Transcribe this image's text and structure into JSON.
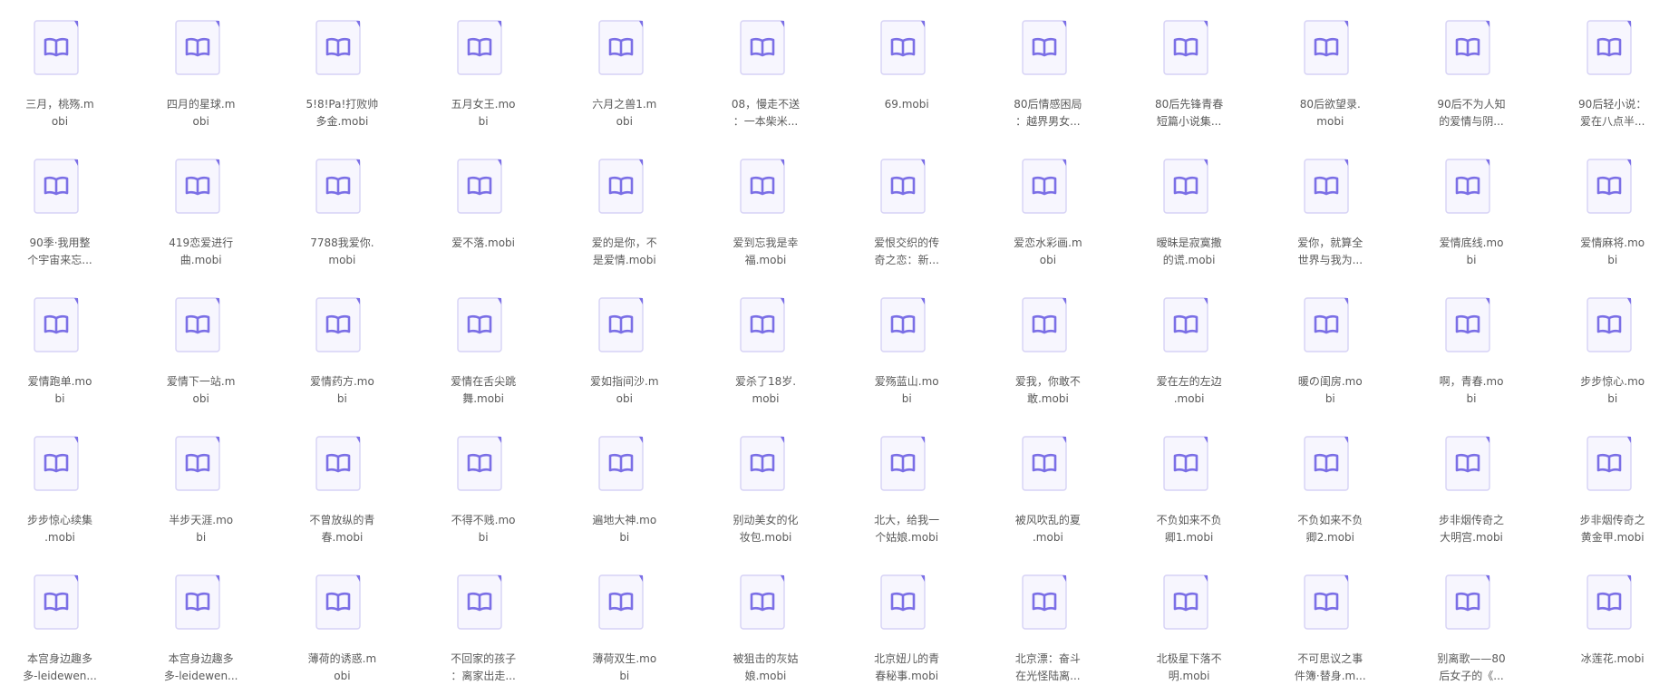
{
  "file_icon": "ebook-file-icon",
  "colors": {
    "icon_outline": "#d6d2f5",
    "icon_fill": "#f7f6fe",
    "icon_accent": "#7b6fe6",
    "text": "#5a5a5a"
  },
  "files": [
    {
      "lines": [
        "三月，桃殇.m",
        "obi"
      ]
    },
    {
      "lines": [
        "四月的星球.m",
        "obi"
      ]
    },
    {
      "lines": [
        "5!8!Pa!打败帅",
        "多金.mobi"
      ]
    },
    {
      "lines": [
        "五月女王.mo",
        "bi"
      ]
    },
    {
      "lines": [
        "六月之兽1.m",
        "obi"
      ]
    },
    {
      "lines": [
        "08，慢走不送",
        "：一本柴米..."
      ]
    },
    {
      "lines": [
        "69.mobi"
      ]
    },
    {
      "lines": [
        "80后情感困局",
        "：越界男女..."
      ]
    },
    {
      "lines": [
        "80后先锋青春",
        "短篇小说集..."
      ]
    },
    {
      "lines": [
        "80后欲望录.",
        "mobi"
      ]
    },
    {
      "lines": [
        "90后不为人知",
        "的爱情与阴..."
      ]
    },
    {
      "lines": [
        "90后轻小说：",
        "爱在八点半..."
      ]
    },
    {
      "lines": [
        "90季·我用整",
        "个宇宙来忘..."
      ]
    },
    {
      "lines": [
        "419恋爱进行",
        "曲.mobi"
      ]
    },
    {
      "lines": [
        "7788我爱你.",
        "mobi"
      ]
    },
    {
      "lines": [
        "爱不落.mobi"
      ]
    },
    {
      "lines": [
        "爱的是你，不",
        "是爱情.mobi"
      ]
    },
    {
      "lines": [
        "爱到忘我是幸",
        "福.mobi"
      ]
    },
    {
      "lines": [
        "爱恨交织的传",
        "奇之恋：新..."
      ]
    },
    {
      "lines": [
        "爱恋水彩画.m",
        "obi"
      ]
    },
    {
      "lines": [
        "暧昧是寂寞撒",
        "的谎.mobi"
      ]
    },
    {
      "lines": [
        "爱你，就算全",
        "世界与我为..."
      ]
    },
    {
      "lines": [
        "爱情底线.mo",
        "bi"
      ]
    },
    {
      "lines": [
        "爱情麻将.mo",
        "bi"
      ]
    },
    {
      "lines": [
        "爱情跑单.mo",
        "bi"
      ]
    },
    {
      "lines": [
        "爱情下一站.m",
        "obi"
      ]
    },
    {
      "lines": [
        "爱情药方.mo",
        "bi"
      ]
    },
    {
      "lines": [
        "爱情在舌尖跳",
        "舞.mobi"
      ]
    },
    {
      "lines": [
        "爱如指间沙.m",
        "obi"
      ]
    },
    {
      "lines": [
        "爱杀了18岁.",
        "mobi"
      ]
    },
    {
      "lines": [
        "爱殇蓝山.mo",
        "bi"
      ]
    },
    {
      "lines": [
        "爱我，你敢不",
        "敢.mobi"
      ]
    },
    {
      "lines": [
        "爱在左的左边",
        ".mobi"
      ]
    },
    {
      "lines": [
        "暖の闺房.mo",
        "bi"
      ]
    },
    {
      "lines": [
        "啊，青春.mo",
        "bi"
      ]
    },
    {
      "lines": [
        "步步惊心.mo",
        "bi"
      ]
    },
    {
      "lines": [
        "步步惊心续集",
        ".mobi"
      ]
    },
    {
      "lines": [
        "半步天涯.mo",
        "bi"
      ]
    },
    {
      "lines": [
        "不曾放纵的青",
        "春.mobi"
      ]
    },
    {
      "lines": [
        "不得不贱.mo",
        "bi"
      ]
    },
    {
      "lines": [
        "遍地大神.mo",
        "bi"
      ]
    },
    {
      "lines": [
        "别动美女的化",
        "妆包.mobi"
      ]
    },
    {
      "lines": [
        "北大，给我一",
        "个姑娘.mobi"
      ]
    },
    {
      "lines": [
        "被风吹乱的夏",
        ".mobi"
      ]
    },
    {
      "lines": [
        "不负如来不负",
        "卿1.mobi"
      ]
    },
    {
      "lines": [
        "不负如来不负",
        "卿2.mobi"
      ]
    },
    {
      "lines": [
        "步非烟传奇之",
        "大明宫.mobi"
      ]
    },
    {
      "lines": [
        "步非烟传奇之",
        "黄金甲.mobi"
      ]
    },
    {
      "lines": [
        "本宫身边趣多",
        "多-leidewen..."
      ]
    },
    {
      "lines": [
        "本宫身边趣多",
        "多-leidewen..."
      ]
    },
    {
      "lines": [
        "薄荷的诱惑.m",
        "obi"
      ]
    },
    {
      "lines": [
        "不回家的孩子",
        "：离家出走..."
      ]
    },
    {
      "lines": [
        "薄荷双生.mo",
        "bi"
      ]
    },
    {
      "lines": [
        "被狙击的灰姑",
        "娘.mobi"
      ]
    },
    {
      "lines": [
        "北京妞儿的青",
        "春秘事.mobi"
      ]
    },
    {
      "lines": [
        "北京漂：奋斗",
        "在光怪陆离..."
      ]
    },
    {
      "lines": [
        "北极星下落不",
        "明.mobi"
      ]
    },
    {
      "lines": [
        "不可思议之事",
        "件簿·替身.m..."
      ]
    },
    {
      "lines": [
        "别离歌——80",
        "后女子的《..."
      ]
    },
    {
      "lines": [
        "冰莲花.mobi"
      ]
    }
  ]
}
